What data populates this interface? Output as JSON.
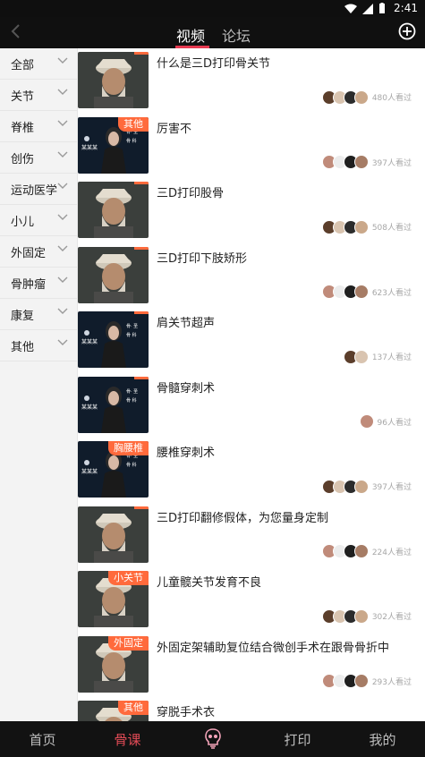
{
  "status": {
    "time": "2:41"
  },
  "topbar": {
    "tabs": [
      {
        "label": "视频",
        "active": true
      },
      {
        "label": "论坛",
        "active": false
      }
    ]
  },
  "sidebar": {
    "items": [
      {
        "label": "全部"
      },
      {
        "label": "关节"
      },
      {
        "label": "脊椎"
      },
      {
        "label": "创伤"
      },
      {
        "label": "运动医学"
      },
      {
        "label": "小儿"
      },
      {
        "label": "外固定"
      },
      {
        "label": "骨肿瘤"
      },
      {
        "label": "康复"
      },
      {
        "label": "其他"
      }
    ]
  },
  "videos": [
    {
      "title": "什么是三D打印骨关节",
      "views": "480人看过",
      "tag": "",
      "thumb": "elder"
    },
    {
      "title": "厉害不",
      "views": "397人看过",
      "tag": "其他",
      "thumb": "woman"
    },
    {
      "title": "三D打印股骨",
      "views": "508人看过",
      "tag": "",
      "thumb": "elder"
    },
    {
      "title": "三D打印下肢矫形",
      "views": "623人看过",
      "tag": "",
      "thumb": "elder"
    },
    {
      "title": "肩关节超声",
      "views": "137人看过",
      "tag": "",
      "thumb": "woman"
    },
    {
      "title": "骨髓穿刺术",
      "views": "96人看过",
      "tag": "",
      "thumb": "woman"
    },
    {
      "title": "腰椎穿刺术",
      "views": "397人看过",
      "tag": "胸腰椎",
      "thumb": "woman"
    },
    {
      "title": "三D打印翻修假体，为您量身定制",
      "views": "224人看过",
      "tag": "",
      "thumb": "elder"
    },
    {
      "title": "儿童髋关节发育不良",
      "views": "302人看过",
      "tag": "小关节",
      "thumb": "elder"
    },
    {
      "title": "外固定架辅助复位结合微创手术在跟骨骨折中",
      "views": "293人看过",
      "tag": "外固定",
      "thumb": "elder"
    },
    {
      "title": "穿脱手术衣",
      "views": "",
      "tag": "其他",
      "thumb": "elder"
    }
  ],
  "thumb_text": {
    "badge_a": "某某某",
    "badge_b": "某某某"
  },
  "bottom_nav": {
    "items": [
      {
        "label": "首页"
      },
      {
        "label": "骨课",
        "active": true
      },
      {
        "label": "",
        "icon": "skull-icon"
      },
      {
        "label": "打印"
      },
      {
        "label": "我的"
      }
    ]
  },
  "colors": {
    "accent": "#e63950",
    "tag": "#ff6a3c",
    "bar": "#101010"
  }
}
